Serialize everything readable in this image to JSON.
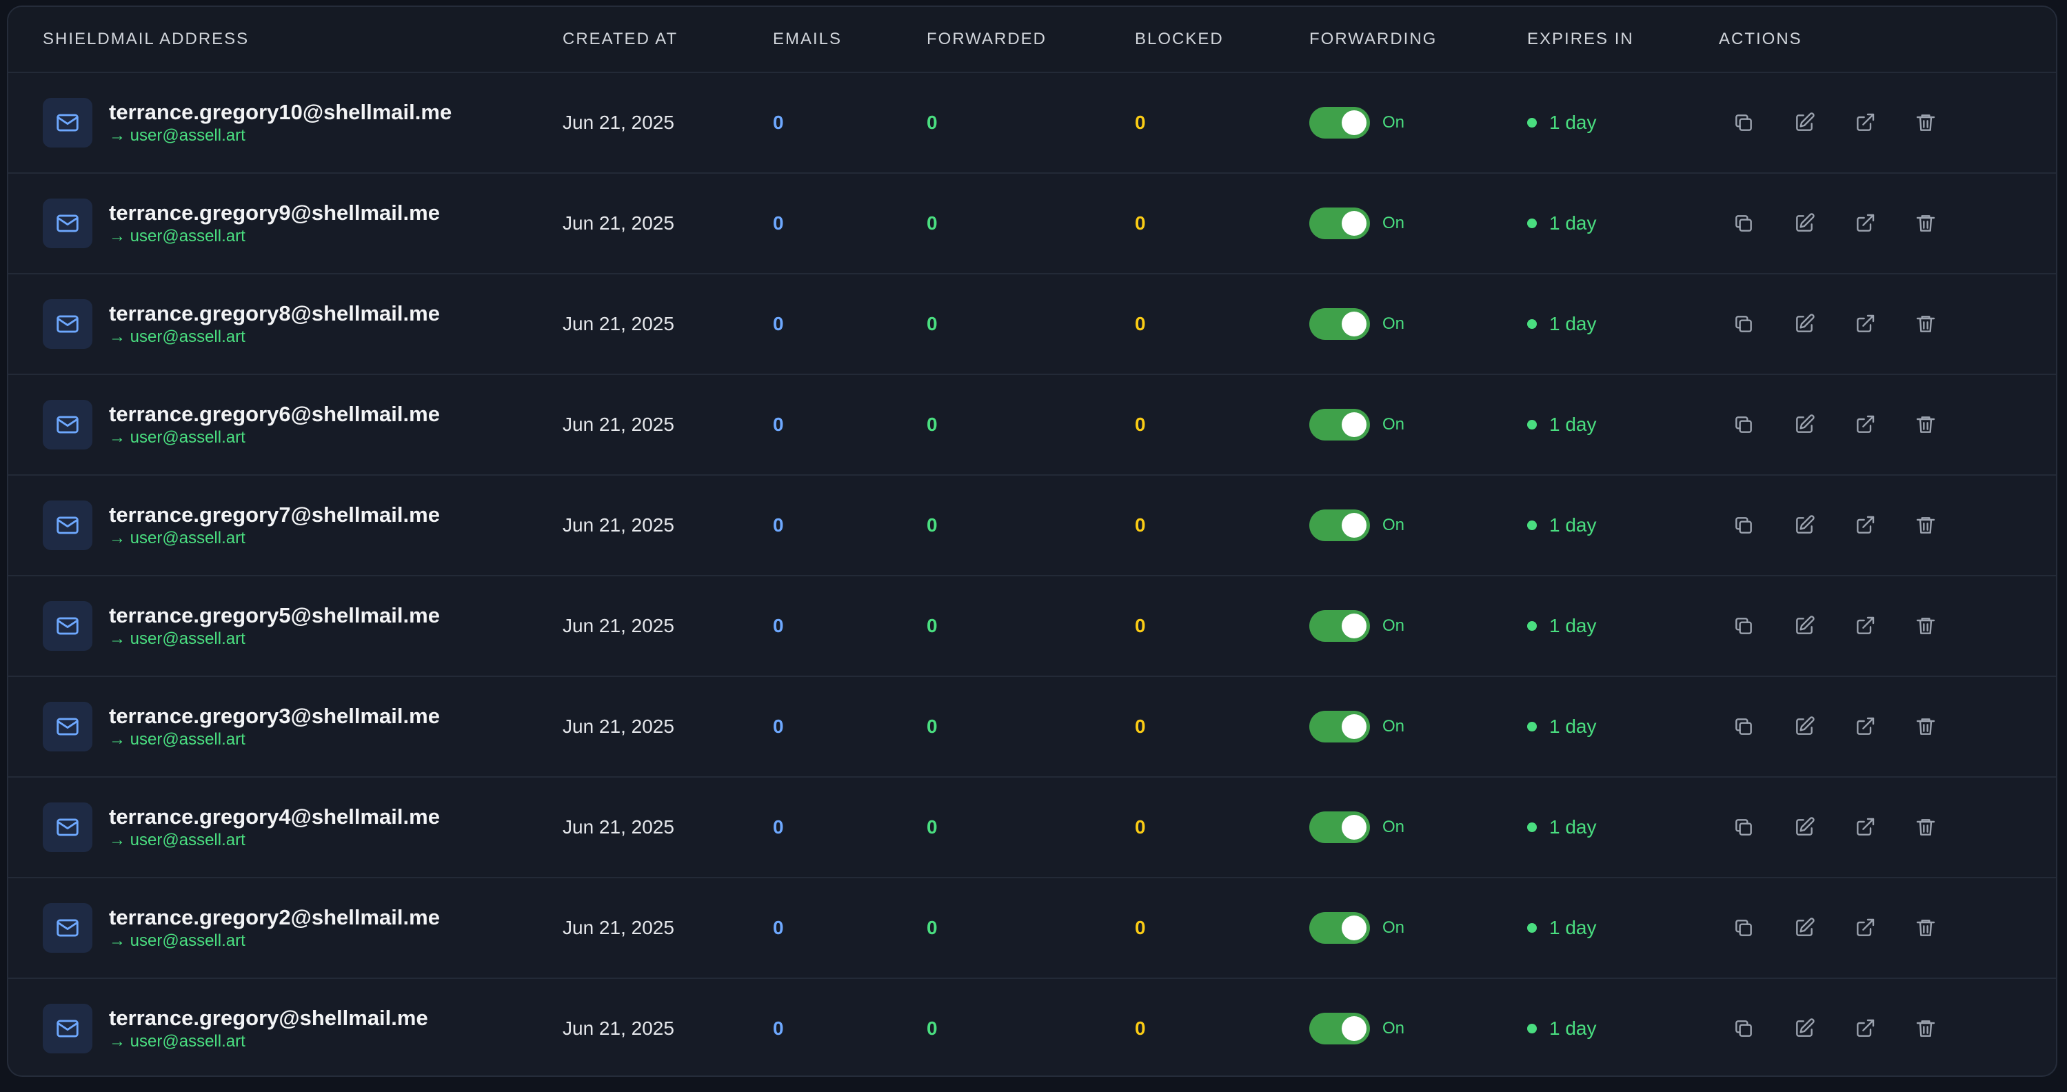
{
  "table": {
    "headers": {
      "address": "SHIELDMAIL ADDRESS",
      "created_at": "CREATED AT",
      "emails": "EMAILS",
      "forwarded": "FORWARDED",
      "blocked": "BLOCKED",
      "forwarding": "FORWARDING",
      "expires_in": "EXPIRES IN",
      "actions": "ACTIONS"
    },
    "rows": [
      {
        "address": "terrance.gregory10@shellmail.me",
        "forward_to": "→ user@assell.art",
        "created": "Jun 21, 2025",
        "emails": "0",
        "forwarded": "0",
        "blocked": "0",
        "forwarding_on": true,
        "forwarding_label": "On",
        "expires": "1 day"
      },
      {
        "address": "terrance.gregory9@shellmail.me",
        "forward_to": "→ user@assell.art",
        "created": "Jun 21, 2025",
        "emails": "0",
        "forwarded": "0",
        "blocked": "0",
        "forwarding_on": true,
        "forwarding_label": "On",
        "expires": "1 day"
      },
      {
        "address": "terrance.gregory8@shellmail.me",
        "forward_to": "→ user@assell.art",
        "created": "Jun 21, 2025",
        "emails": "0",
        "forwarded": "0",
        "blocked": "0",
        "forwarding_on": true,
        "forwarding_label": "On",
        "expires": "1 day"
      },
      {
        "address": "terrance.gregory6@shellmail.me",
        "forward_to": "→ user@assell.art",
        "created": "Jun 21, 2025",
        "emails": "0",
        "forwarded": "0",
        "blocked": "0",
        "forwarding_on": true,
        "forwarding_label": "On",
        "expires": "1 day"
      },
      {
        "address": "terrance.gregory7@shellmail.me",
        "forward_to": "→ user@assell.art",
        "created": "Jun 21, 2025",
        "emails": "0",
        "forwarded": "0",
        "blocked": "0",
        "forwarding_on": true,
        "forwarding_label": "On",
        "expires": "1 day"
      },
      {
        "address": "terrance.gregory5@shellmail.me",
        "forward_to": "→ user@assell.art",
        "created": "Jun 21, 2025",
        "emails": "0",
        "forwarded": "0",
        "blocked": "0",
        "forwarding_on": true,
        "forwarding_label": "On",
        "expires": "1 day"
      },
      {
        "address": "terrance.gregory3@shellmail.me",
        "forward_to": "→ user@assell.art",
        "created": "Jun 21, 2025",
        "emails": "0",
        "forwarded": "0",
        "blocked": "0",
        "forwarding_on": true,
        "forwarding_label": "On",
        "expires": "1 day"
      },
      {
        "address": "terrance.gregory4@shellmail.me",
        "forward_to": "→ user@assell.art",
        "created": "Jun 21, 2025",
        "emails": "0",
        "forwarded": "0",
        "blocked": "0",
        "forwarding_on": true,
        "forwarding_label": "On",
        "expires": "1 day"
      },
      {
        "address": "terrance.gregory2@shellmail.me",
        "forward_to": "→ user@assell.art",
        "created": "Jun 21, 2025",
        "emails": "0",
        "forwarded": "0",
        "blocked": "0",
        "forwarding_on": true,
        "forwarding_label": "On",
        "expires": "1 day"
      },
      {
        "address": "terrance.gregory@shellmail.me",
        "forward_to": "→ user@assell.art",
        "created": "Jun 21, 2025",
        "emails": "0",
        "forwarded": "0",
        "blocked": "0",
        "forwarding_on": true,
        "forwarding_label": "On",
        "expires": "1 day"
      }
    ],
    "row_icons": {
      "address": "mail-icon",
      "actions": [
        "copy-icon",
        "edit-icon",
        "external-link-icon",
        "trash-icon"
      ]
    }
  },
  "colors": {
    "background": "#0f131c",
    "card": "#161b26",
    "emails": "#6ea8fe",
    "forwarded": "#4ade80",
    "blocked": "#facc15",
    "toggle_on": "#3fa14a",
    "status_green": "#4ade80"
  }
}
